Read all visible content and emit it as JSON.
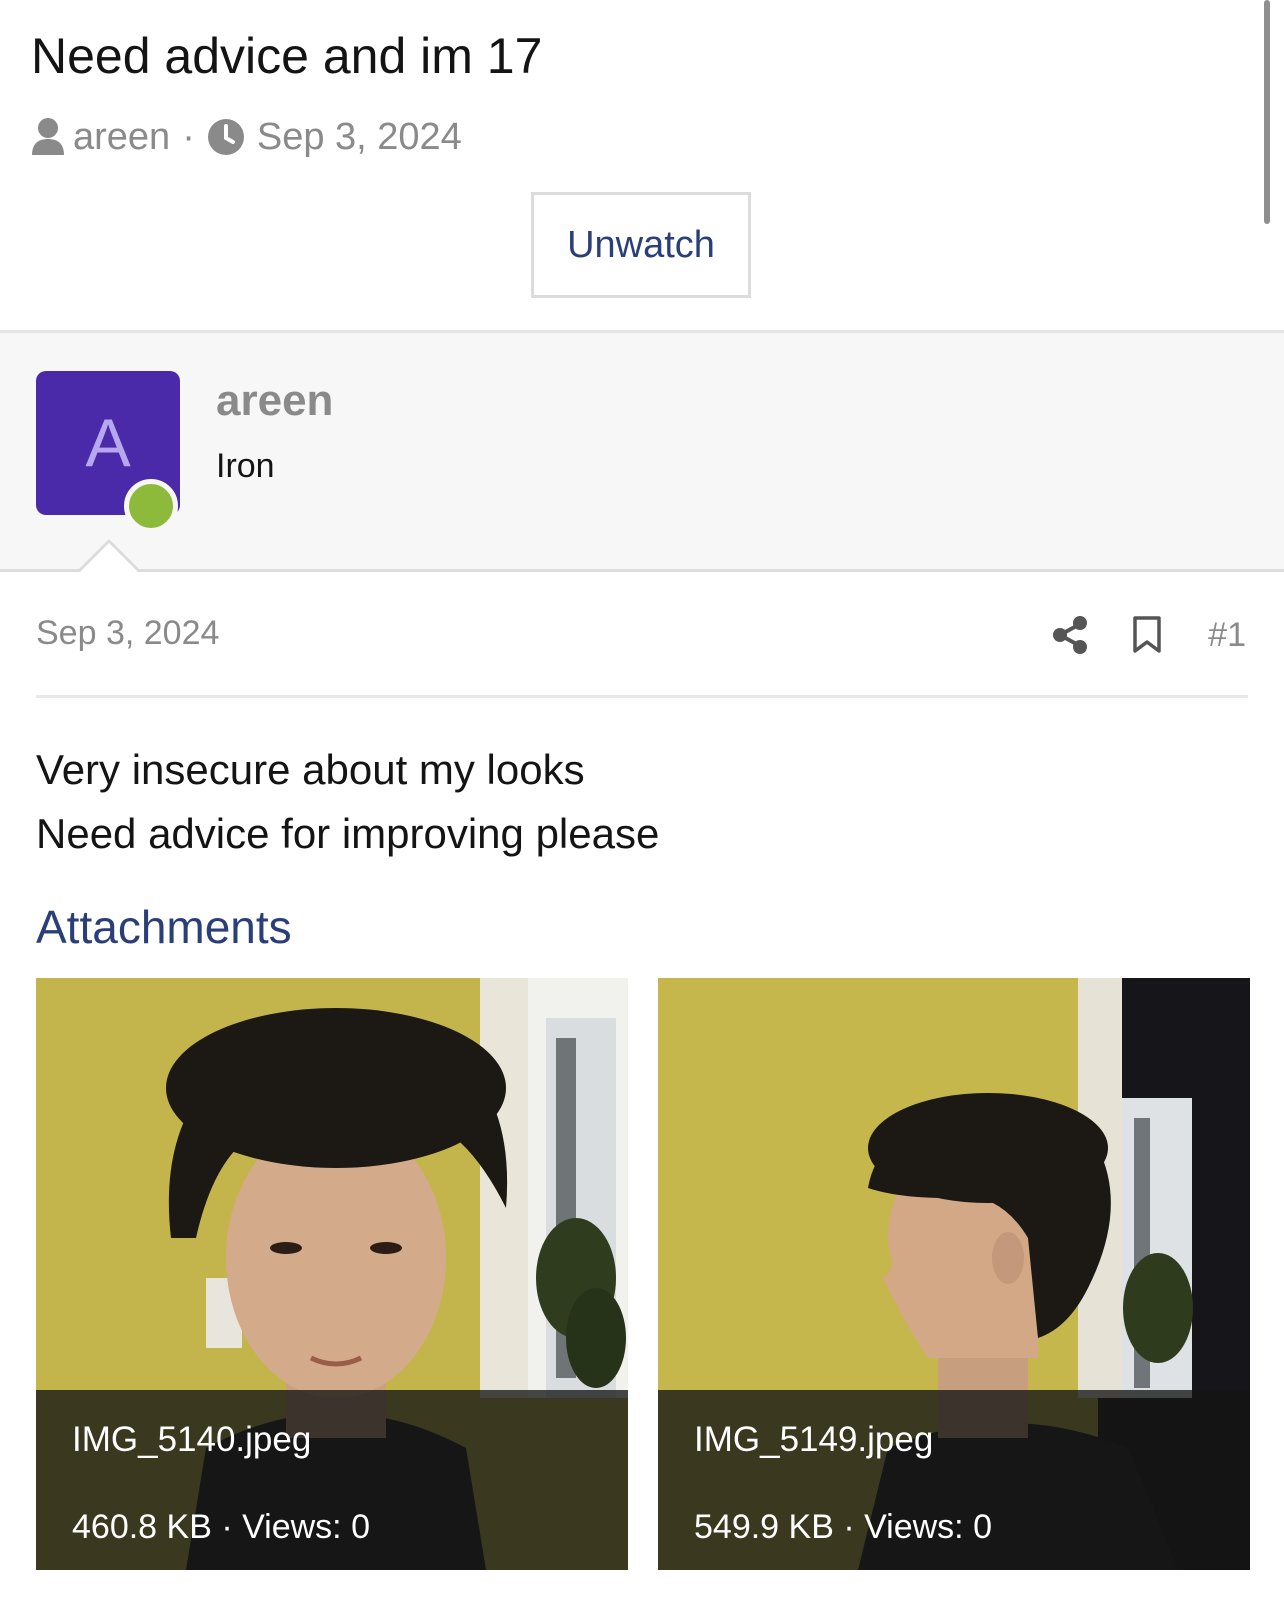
{
  "thread": {
    "title": "Need advice and im 17",
    "author": "areen",
    "separator": "·",
    "date": "Sep 3, 2024",
    "watch_button_label": "Unwatch"
  },
  "user": {
    "avatar_letter": "A",
    "name": "areen",
    "rank": "Iron",
    "avatar_color": "#4a2aa8",
    "online_color": "#8dba3b"
  },
  "post": {
    "date": "Sep 3, 2024",
    "number": "#1",
    "body_lines": [
      "Very insecure about my looks",
      "Need advice for improving please"
    ]
  },
  "attachments": {
    "heading": "Attachments",
    "items": [
      {
        "filename": "IMG_5140.jpeg",
        "meta": "460.8 KB · Views: 0"
      },
      {
        "filename": "IMG_5149.jpeg",
        "meta": "549.9 KB · Views: 0"
      }
    ]
  },
  "colors": {
    "link": "#2a3f7a",
    "muted": "#8a8a8a"
  }
}
